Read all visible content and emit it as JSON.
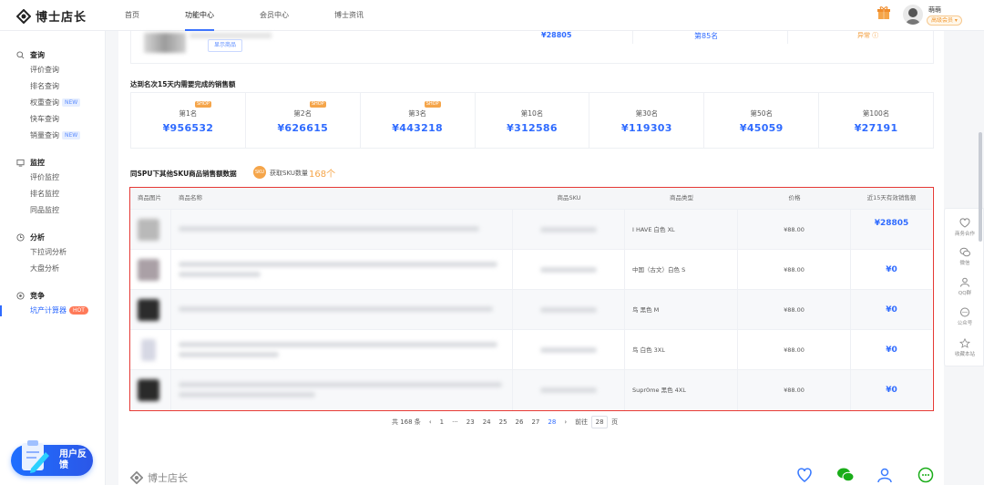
{
  "brand": {
    "name": "博士店长"
  },
  "nav": [
    "首页",
    "功能中心",
    "会员中心",
    "博士资讯"
  ],
  "user": {
    "name": "萌萌",
    "badge": "高级会员 ▾"
  },
  "sidebar": {
    "groups": [
      {
        "title": "查询",
        "items": [
          {
            "label": "评价查询",
            "tag": ""
          },
          {
            "label": "排名查询",
            "tag": ""
          },
          {
            "label": "权重查询",
            "tag": "NEW"
          },
          {
            "label": "快车查询",
            "tag": ""
          },
          {
            "label": "销量查询",
            "tag": "NEW"
          }
        ]
      },
      {
        "title": "监控",
        "items": [
          {
            "label": "评价监控",
            "tag": ""
          },
          {
            "label": "排名监控",
            "tag": ""
          },
          {
            "label": "同品监控",
            "tag": ""
          }
        ]
      },
      {
        "title": "分析",
        "items": [
          {
            "label": "下拉词分析",
            "tag": ""
          },
          {
            "label": "大盘分析",
            "tag": ""
          }
        ]
      },
      {
        "title": "竞争",
        "items": [
          {
            "label": "坑产计算器",
            "tag": "HOT"
          }
        ]
      }
    ],
    "feedback": "用户反馈"
  },
  "prev": {
    "button": "显示商品",
    "sales": "¥28805",
    "rank": "第85名",
    "status": "异常 ⓘ"
  },
  "ranks": {
    "title": "达到名次15天内需要完成的销售额",
    "shop_tag": "SHOP",
    "items": [
      {
        "label": "第1名",
        "value": "¥956532",
        "shop": true
      },
      {
        "label": "第2名",
        "value": "¥626615",
        "shop": true
      },
      {
        "label": "第3名",
        "value": "¥443218",
        "shop": true
      },
      {
        "label": "第10名",
        "value": "¥312586",
        "shop": false
      },
      {
        "label": "第30名",
        "value": "¥119303",
        "shop": false
      },
      {
        "label": "第50名",
        "value": "¥45059",
        "shop": false
      },
      {
        "label": "第100名",
        "value": "¥27191",
        "shop": false
      }
    ]
  },
  "sku": {
    "title": "同SPU下其他SKU商品销售额数据",
    "badge": "SKU",
    "count_label": "获取SKU数量",
    "count": "168个"
  },
  "table": {
    "headers": [
      "商品图片",
      "商品名称",
      "商品SKU",
      "商品类型",
      "价格",
      "近15天有效销售额"
    ],
    "rows": [
      {
        "type": "I HAVE 白色  XL",
        "price": "¥88.00",
        "sales": "¥28805"
      },
      {
        "type": "中国（古文）白色  S",
        "price": "¥88.00",
        "sales": "¥0"
      },
      {
        "type": "鸟 黑色  M",
        "price": "¥88.00",
        "sales": "¥0"
      },
      {
        "type": "鸟 白色  3XL",
        "price": "¥88.00",
        "sales": "¥0"
      },
      {
        "type": "Supr0me 黑色  4XL",
        "price": "¥88.00",
        "sales": "¥0"
      }
    ]
  },
  "pager": {
    "total": "共 168 条",
    "pages": [
      "1",
      "···",
      "23",
      "24",
      "25",
      "26",
      "27",
      "28"
    ],
    "current": "28",
    "goto_label": "前往",
    "goto_value": "28",
    "page_suffix": "页"
  },
  "floatbar": [
    "商务合作",
    "微信",
    "QQ群",
    "公众号",
    "收藏本站"
  ],
  "colors": {
    "accent": "#2f6bff",
    "orange": "#f5a54a",
    "highlight": "#e53935"
  }
}
